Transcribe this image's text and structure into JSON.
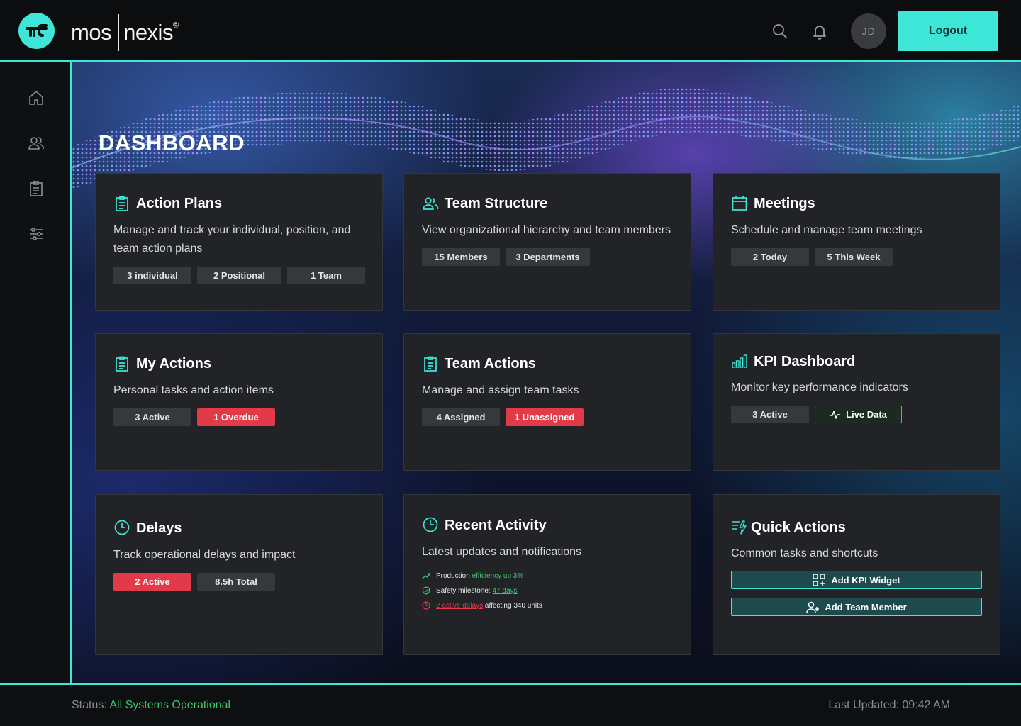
{
  "brand": {
    "name_left": "mos",
    "name_right": "nexis",
    "reg": "®"
  },
  "header": {
    "avatar_initials": "JD",
    "logout_label": "Logout"
  },
  "sidebar": {
    "items": [
      {
        "icon": "home-icon"
      },
      {
        "icon": "users-icon"
      },
      {
        "icon": "clipboard-icon"
      },
      {
        "icon": "sliders-icon"
      }
    ]
  },
  "page": {
    "title": "DASHBOARD"
  },
  "cards": {
    "action_plans": {
      "title": "Action Plans",
      "desc": "Manage and track your individual, position, and team action plans",
      "badges": [
        "3 individual",
        "2 Positional",
        "1 Team"
      ]
    },
    "team_structure": {
      "title": "Team Structure",
      "desc": "View organizational hierarchy and team members",
      "badges": [
        "15 Members",
        "3 Departments"
      ]
    },
    "meetings": {
      "title": "Meetings",
      "desc": "Schedule and manage team meetings",
      "badges": [
        "2 Today",
        "5 This Week"
      ]
    },
    "my_actions": {
      "title": "My Actions",
      "desc": "Personal tasks and action items",
      "badges": [
        "3 Active",
        "1 Overdue"
      ]
    },
    "team_actions": {
      "title": "Team Actions",
      "desc": "Manage and assign team tasks",
      "badges": [
        "4 Assigned",
        "1 Unassigned"
      ]
    },
    "kpi": {
      "title": "KPI Dashboard",
      "desc": "Monitor key performance indicators",
      "badges": [
        "3 Active",
        "Live Data"
      ]
    },
    "delays": {
      "title": "Delays",
      "desc": "Track operational delays and impact",
      "badges": [
        "2 Active",
        "8.5h Total"
      ]
    },
    "recent": {
      "title": "Recent Activity",
      "desc": "Latest updates and notifications",
      "items": [
        {
          "prefix": "Production ",
          "link": "efficiency up 3%",
          "suffix": ""
        },
        {
          "prefix": "Safety milestone: ",
          "link": "47 days",
          "suffix": ""
        },
        {
          "prefix": "",
          "link": "2 active delays",
          "suffix": " affecting 340 units"
        }
      ]
    },
    "quick": {
      "title": "Quick Actions",
      "desc": "Common tasks and shortcuts",
      "buttons": [
        "Add KPI Widget",
        "Add Team Member"
      ]
    }
  },
  "footer": {
    "status_label": "Status:",
    "status_value": "All Systems Operational",
    "updated": "Last Updated: 09:42 AM"
  },
  "colors": {
    "accent": "#3ee6d8",
    "danger": "#e23a48",
    "success": "#3cc86a"
  }
}
